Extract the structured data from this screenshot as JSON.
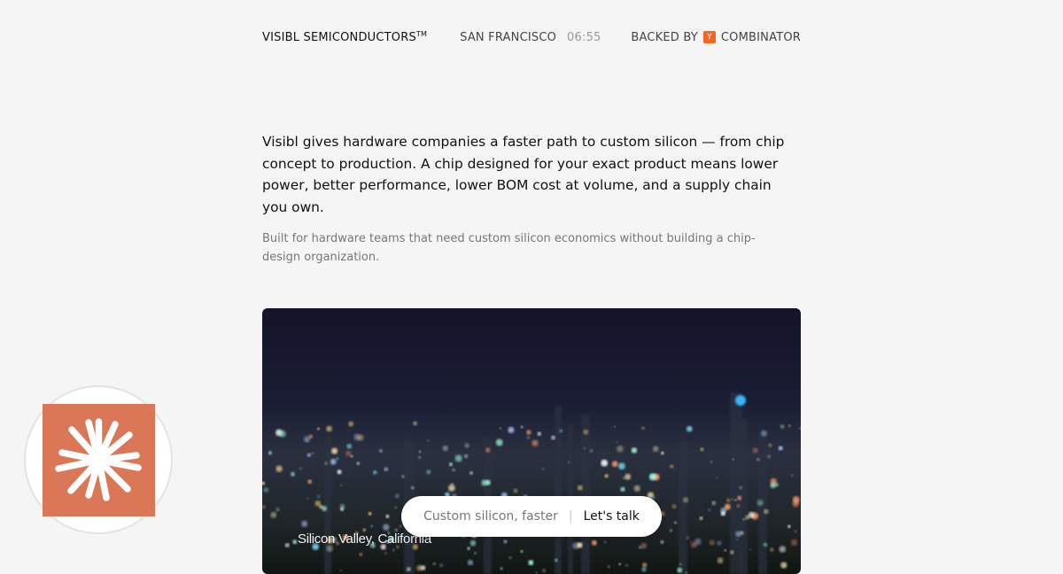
{
  "header": {
    "brand": "VISIBL SEMICONDUCTORS",
    "brand_mark": "TM",
    "city": "SAN FRANCISCO",
    "time": "06:55",
    "backed_prefix": "BACKED BY",
    "backer_logo_letter": "Y",
    "backer_name": "COMBINATOR"
  },
  "intro": {
    "lead": "Visibl gives hardware companies a faster path to custom silicon — from chip concept to production. A chip designed for your exact product means lower power, better performance, lower BOM cost at volume, and a supply chain you own.",
    "sub": "Built for hardware teams that need custom silicon economics without building a chip-design organization."
  },
  "hero": {
    "caption": "Silicon Valley, California"
  },
  "cta": {
    "text": "Custom silicon, faster",
    "separator": "|",
    "link": "Let's talk"
  },
  "badge": {
    "icon": "starburst-icon",
    "color": "#d97757"
  },
  "colors": {
    "accent": "#f26522",
    "badge": "#d97757",
    "background": "#f5f5f5"
  }
}
